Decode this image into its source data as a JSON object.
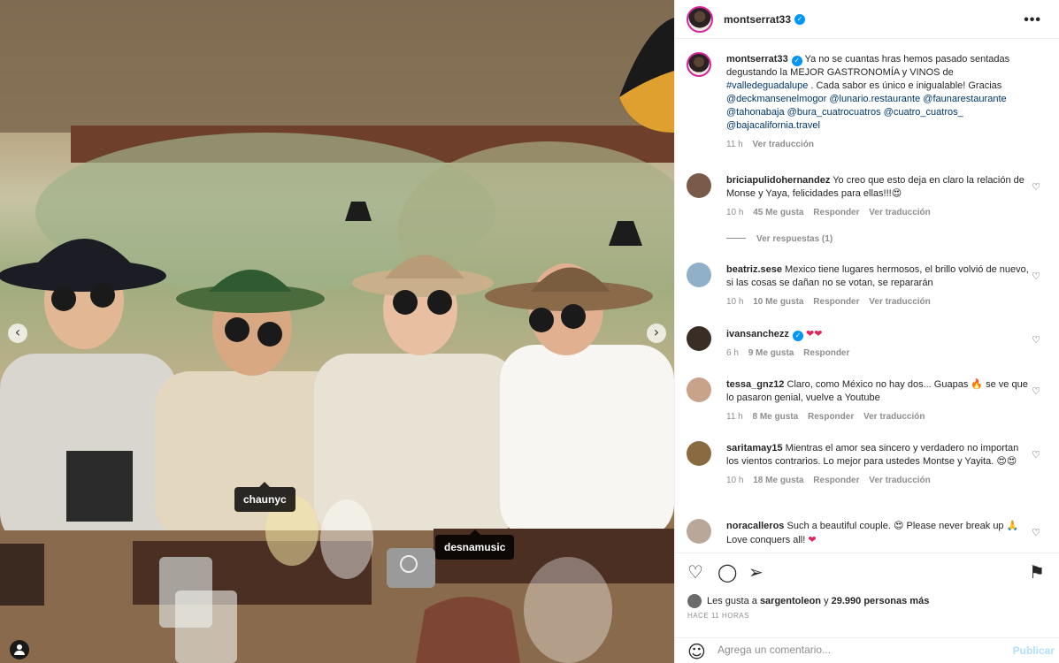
{
  "post": {
    "author": "montserrat33",
    "more_label": "•••"
  },
  "photo": {
    "tags": [
      "chaunyc",
      "desnamusic"
    ],
    "nav_prev": "‹",
    "nav_next": "›"
  },
  "caption": {
    "user": "montserrat33",
    "text_1": " Ya no se cuantas hras hemos pasado sentadas degustando la MEJOR GASTRONOMÍA y VINOS de ",
    "hashtag": "#valledeguadalupe",
    "text_2": " . Cada sabor es único e inigualable! Gracias ",
    "mentions": "@deckmansenelmogor @lunario.restaurante @faunarestaurante @tahonabaja @bura_cuatrocuatros @cuatro_cuatros_ @bajacalifornia.travel",
    "time": "11 h",
    "translate": "Ver traducción"
  },
  "comments": [
    {
      "user": "briciapulidohernandez",
      "text": "Yo creo que esto deja en claro la relación de Monse y Yaya, felicidades para ellas!!!",
      "emoji": "😍",
      "time": "10 h",
      "likes": "45 Me gusta",
      "reply": "Responder",
      "translate": "Ver traducción",
      "avatar_color": "#7a5a4a"
    },
    {
      "user": "beatriz.sese",
      "text": "Mexico tiene lugares hermosos, el brillo volvió de nuevo, si las cosas se dañan no se votan, se repararán",
      "emoji": "",
      "time": "10 h",
      "likes": "10 Me gusta",
      "reply": "Responder",
      "translate": "Ver traducción",
      "avatar_color": "#8fb0c8"
    },
    {
      "user": "ivansanchezz",
      "text": "",
      "emoji": "❤❤",
      "time": "6 h",
      "likes": "9 Me gusta",
      "reply": "Responder",
      "translate": "",
      "avatar_color": "#3a2d25"
    },
    {
      "user": "tessa_gnz12",
      "text": "Claro, como México no hay dos... Guapas 🔥 se ve que lo pasaron genial, vuelve a Youtube",
      "emoji": "",
      "time": "11 h",
      "likes": "8 Me gusta",
      "reply": "Responder",
      "translate": "Ver traducción",
      "avatar_color": "#c9a28a"
    },
    {
      "user": "saritamay15",
      "text": "Mientras el amor sea sincero y verdadero no importan los vientos contrarios. Lo mejor para ustedes Montse y Yayita.",
      "emoji": "😍😍",
      "time": "10 h",
      "likes": "18 Me gusta",
      "reply": "Responder",
      "translate": "Ver traducción",
      "avatar_color": "#8a6a40"
    },
    {
      "user": "noracalleros",
      "text": "Such a beautiful couple. 😍 Please never break up 🙏 Love conquers all!",
      "emoji": "❤",
      "time": "",
      "likes": "",
      "reply": "",
      "translate": "",
      "avatar_color": "#b9a79a"
    }
  ],
  "view_replies": "Ver respuestas (1)",
  "likes_line": {
    "prefix": "Les gusta a ",
    "user": "sargentoleon",
    "middle": " y ",
    "count": "29.990 personas más"
  },
  "time_ago": "HACE 11 HORAS",
  "comment_box": {
    "placeholder": "Agrega un comentario...",
    "post_label": "Publicar"
  },
  "icons": {
    "like": "heart-icon",
    "comment": "comment-icon",
    "share": "share-icon",
    "save": "bookmark-icon",
    "emoji": "smiley-icon",
    "more": "more-icon",
    "verified": "verified-badge-icon"
  },
  "colors": {
    "link": "#00376b",
    "verified": "#0095f6",
    "muted": "#8e8e8e",
    "post_button": "#b2dffc"
  }
}
